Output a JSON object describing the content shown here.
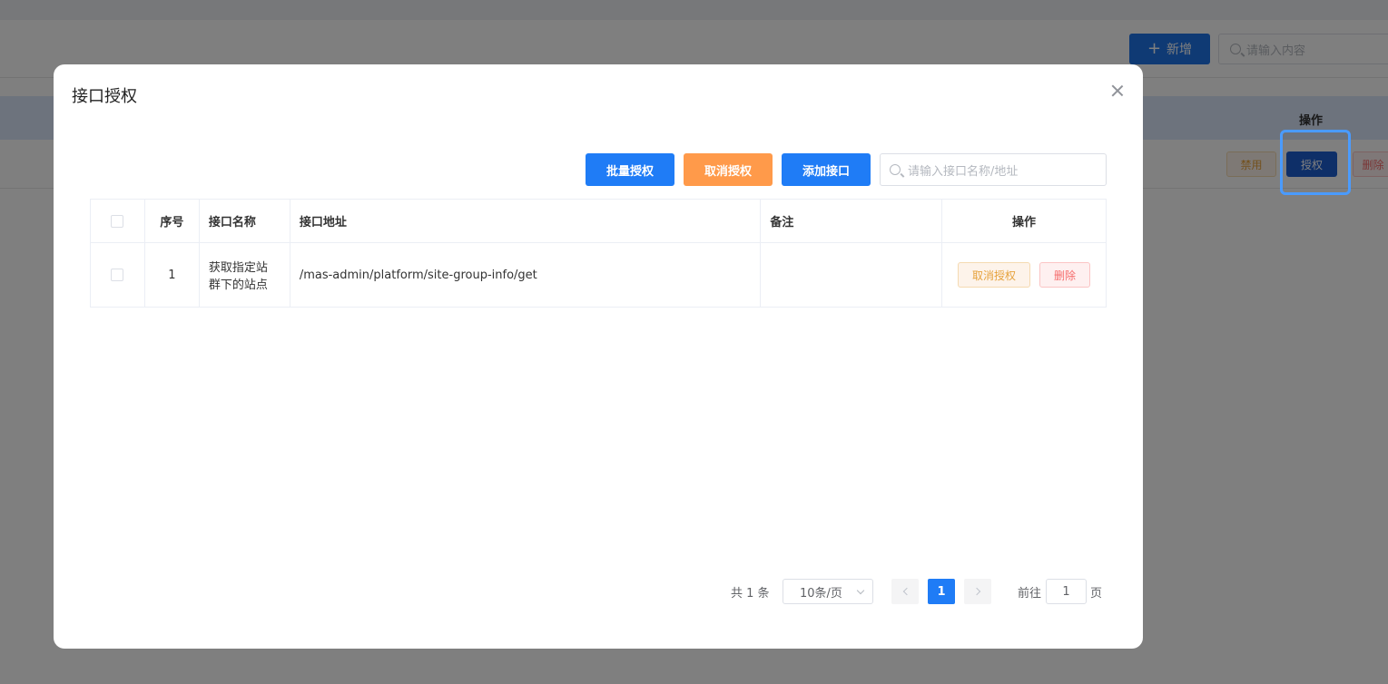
{
  "background": {
    "add_button_label": "新增",
    "search_placeholder": "请输入内容",
    "table_op_header": "操作",
    "row_buttons": {
      "disable": "禁用",
      "authorize": "授权",
      "delete": "删除"
    }
  },
  "dialog": {
    "title": "接口授权",
    "toolbar": {
      "batch_authorize": "批量授权",
      "cancel_authorize": "取消授权",
      "add_api": "添加接口",
      "search_placeholder": "请输入接口名称/地址"
    },
    "table": {
      "headers": {
        "index": "序号",
        "name": "接口名称",
        "url": "接口地址",
        "remark": "备注",
        "operation": "操作"
      },
      "rows": [
        {
          "index": "1",
          "name_line1": "获取指定站",
          "name_line2": "群下的站点",
          "url": "/mas-admin/platform/site-group-info/get",
          "remark": "",
          "cancel_label": "取消授权",
          "delete_label": "删除"
        }
      ]
    },
    "pagination": {
      "total_text": "共 1 条",
      "page_size": "10条/页",
      "current_page": "1",
      "goto_label": "前往",
      "goto_value": "1",
      "page_suffix": "页"
    }
  },
  "colors": {
    "primary": "#1f7cf6",
    "warning": "#ff9a4a",
    "highlight": "#4a9bff"
  }
}
